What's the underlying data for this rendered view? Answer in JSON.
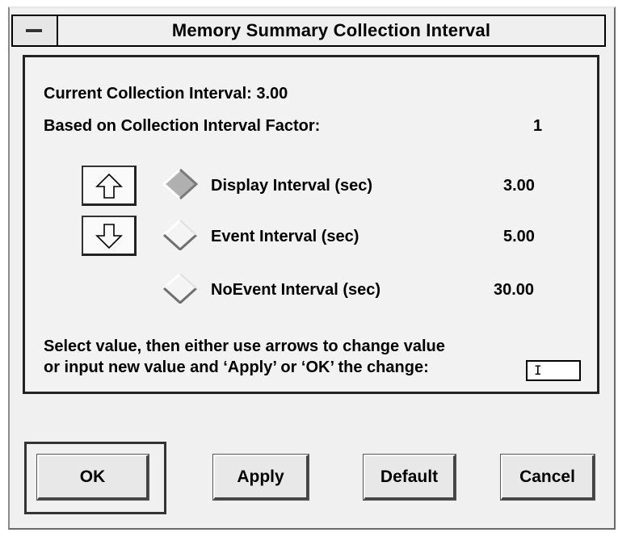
{
  "window": {
    "title": "Memory Summary Collection Interval"
  },
  "info": {
    "current_label": "Current Collection Interval: 3.00",
    "factor_label": "Based on Collection Interval Factor:",
    "factor_value": "1"
  },
  "intervals": [
    {
      "label": "Display Interval (sec)",
      "value": "3.00",
      "selected": true
    },
    {
      "label": "Event Interval (sec)",
      "value": "5.00",
      "selected": false
    },
    {
      "label": "NoEvent Interval (sec)",
      "value": "30.00",
      "selected": false
    }
  ],
  "instructions": {
    "line1": "Select value, then either use arrows to change value",
    "line2": "or input new value and ‘Apply’ or ‘OK’ the change:"
  },
  "input": {
    "value": "I"
  },
  "buttons": {
    "ok": "OK",
    "apply": "Apply",
    "default": "Default",
    "cancel": "Cancel"
  },
  "icons": {
    "increase": "arrow-up-icon",
    "decrease": "arrow-down-icon",
    "window_menu": "window-menu-icon"
  }
}
